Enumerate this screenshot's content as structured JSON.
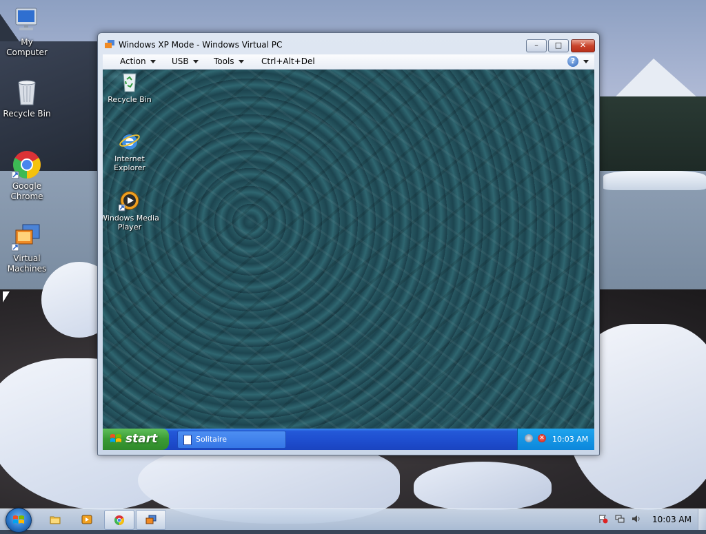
{
  "desktop_icons": [
    {
      "name": "My Computer"
    },
    {
      "name": "Recycle Bin"
    },
    {
      "name": "Google\nChrome",
      "l1": "Google",
      "l2": "Chrome"
    },
    {
      "name": "Virtual\nMachines",
      "l1": "Virtual",
      "l2": "Machines"
    }
  ],
  "window": {
    "title": "Windows XP Mode - Windows Virtual PC",
    "controls": {
      "minimize": "–",
      "maximize": "□",
      "close": "✕"
    },
    "menu": {
      "action": "Action",
      "usb": "USB",
      "tools": "Tools",
      "cad": "Ctrl+Alt+Del",
      "help": "?"
    }
  },
  "guest": {
    "icons": [
      {
        "l1": "Recycle Bin",
        "l2": ""
      },
      {
        "l1": "Internet",
        "l2": "Explorer"
      },
      {
        "l1": "Windows Media",
        "l2": "Player"
      }
    ],
    "taskbar": {
      "start": "start",
      "task": "Solitaire",
      "clock": "10:03 AM"
    }
  },
  "host_taskbar": {
    "clock": "10:03 AM",
    "pinned": [
      "windows-explorer-icon",
      "media-player-icon",
      "chrome-icon",
      "virtual-pc-icon"
    ]
  },
  "colors": {
    "xp_taskbar": "#2459d8",
    "xp_start": "#3a9a34",
    "xp_tray": "#0c87db",
    "close_red": "#c9442c"
  }
}
